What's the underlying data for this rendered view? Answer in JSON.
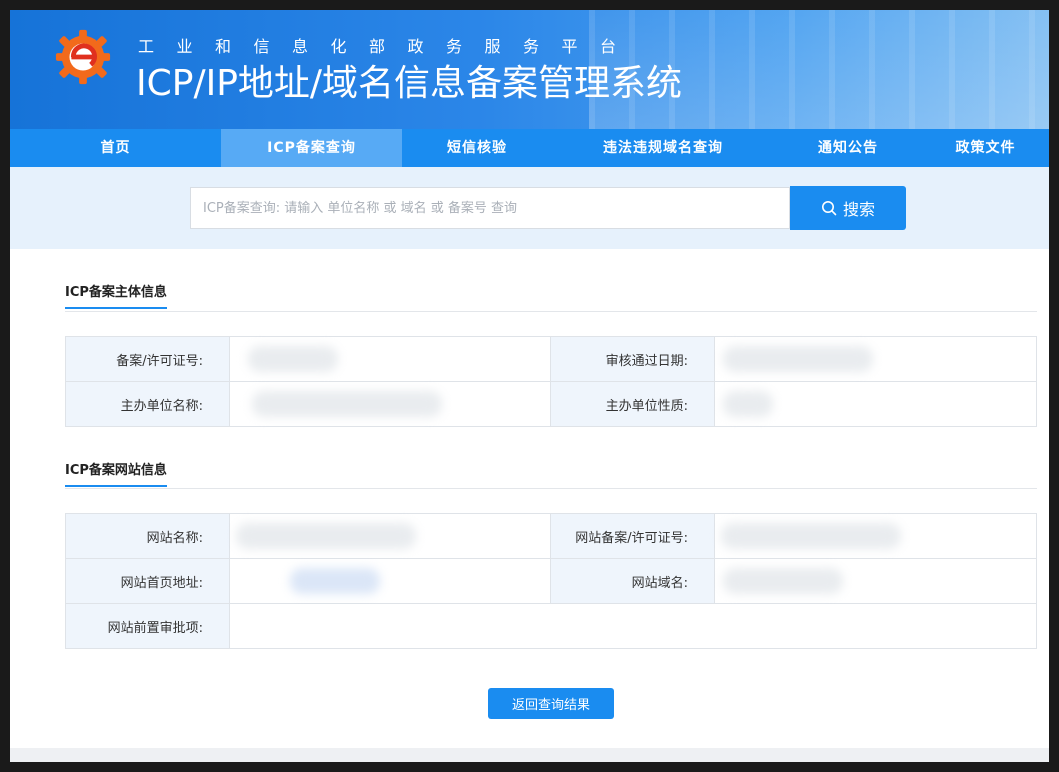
{
  "header": {
    "subtitle": "工业和信息化部政务服务平台",
    "title": "ICP/IP地址/域名信息备案管理系统",
    "logo_icon": "e-gear-logo-icon"
  },
  "nav": {
    "items": [
      {
        "label": "首页"
      },
      {
        "label": "ICP备案查询",
        "active": true
      },
      {
        "label": "短信核验"
      },
      {
        "label": "违法违规域名查询"
      },
      {
        "label": "通知公告"
      },
      {
        "label": "政策文件"
      }
    ]
  },
  "search": {
    "placeholder": "ICP备案查询: 请输入 单位名称 或 域名 或 备案号 查询",
    "value": "",
    "button_label": "搜索",
    "button_icon": "search-icon"
  },
  "subject": {
    "title": "ICP备案主体信息",
    "license_label": "备案/许可证号:",
    "approve_date_label": "审核通过日期:",
    "org_name_label": "主办单位名称:",
    "org_type_label": "主办单位性质:"
  },
  "website": {
    "title": "ICP备案网站信息",
    "site_name_label": "网站名称:",
    "site_license_label": "网站备案/许可证号:",
    "homepage_label": "网站首页地址:",
    "domain_label": "网站域名:",
    "preapproval_label": "网站前置审批项:"
  },
  "back_button": "返回查询结果",
  "colors": {
    "primary": "#1a8cf0",
    "nav_active": "#57aaf5",
    "label_bg": "#eff5fc"
  }
}
